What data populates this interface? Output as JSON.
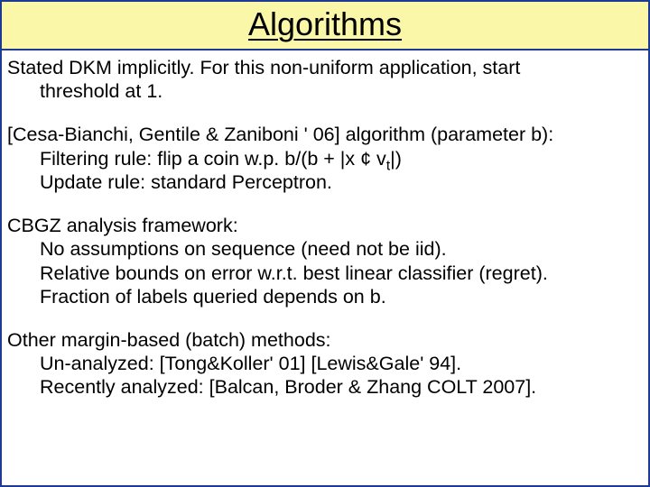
{
  "title": "Algorithms",
  "p1": {
    "line1": "Stated DKM implicitly.  For this non-uniform application, start",
    "line2": "threshold at 1."
  },
  "p2": {
    "line1": "[Cesa-Bianchi, Gentile & Zaniboni ' 06] algorithm (parameter b):",
    "line2_pre": "Filtering rule: flip a coin w.p. b/(b + |x ¢ v",
    "line2_sub": "t",
    "line2_post": "|)",
    "line3": "Update rule: standard Perceptron."
  },
  "p3": {
    "line1": "CBGZ analysis framework:",
    "line2": "No assumptions on sequence (need not be iid).",
    "line3": "Relative bounds on error w.r.t. best linear classifier (regret).",
    "line4": "Fraction of labels queried depends on b."
  },
  "p4": {
    "line1": "Other margin-based (batch) methods:",
    "line2": "Un-analyzed: [Tong&Koller' 01] [Lewis&Gale' 94].",
    "line3": "Recently analyzed: [Balcan, Broder & Zhang COLT 2007]."
  }
}
